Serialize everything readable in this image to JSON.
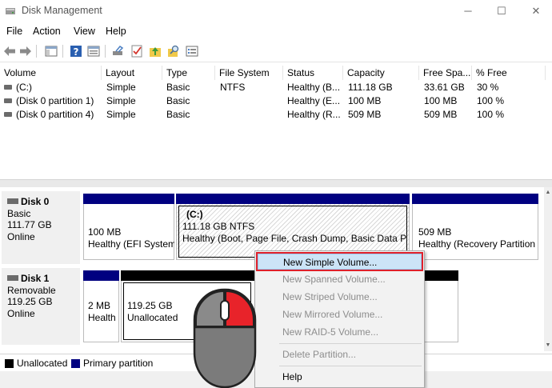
{
  "window": {
    "title": "Disk Management",
    "controls": {
      "minimize": "─",
      "maximize": "☐",
      "close": "✕"
    }
  },
  "menu": [
    "File",
    "Action",
    "View",
    "Help"
  ],
  "toolbar_icons": [
    "back-arrow-icon",
    "forward-arrow-icon",
    "console-tree-icon",
    "help-icon",
    "properties-icon",
    "connect-drive-icon",
    "check-icon",
    "up-folder-icon",
    "search-icon",
    "list-view-icon"
  ],
  "volumes": {
    "columns": [
      "Volume",
      "Layout",
      "Type",
      "File System",
      "Status",
      "Capacity",
      "Free Spa...",
      "% Free"
    ],
    "rows": [
      [
        "(C:)",
        "Simple",
        "Basic",
        "NTFS",
        "Healthy (B...",
        "111.18 GB",
        "33.61 GB",
        "30 %"
      ],
      [
        "(Disk 0 partition 1)",
        "Simple",
        "Basic",
        "",
        "Healthy (E...",
        "100 MB",
        "100 MB",
        "100 %"
      ],
      [
        "(Disk 0 partition 4)",
        "Simple",
        "Basic",
        "",
        "Healthy (R...",
        "509 MB",
        "509 MB",
        "100 %"
      ]
    ]
  },
  "disks": [
    {
      "name": "Disk 0",
      "type": "Basic",
      "size": "111.77 GB",
      "state": "Online",
      "partitions": [
        {
          "title": "",
          "line1": "100 MB",
          "line2": "Healthy (EFI System"
        },
        {
          "title": "(C:)",
          "line1": "111.18 GB NTFS",
          "line2": "Healthy (Boot, Page File, Crash Dump, Basic Data Parti"
        },
        {
          "title": "",
          "line1": "509 MB",
          "line2": "Healthy (Recovery Partition"
        }
      ]
    },
    {
      "name": "Disk 1",
      "type": "Removable",
      "size": "119.25 GB",
      "state": "Online",
      "partitions": [
        {
          "title": "",
          "line1": "2 MB",
          "line2": "Health"
        },
        {
          "title": "",
          "line1": "119.25 GB",
          "line2": "Unallocated"
        }
      ]
    }
  ],
  "legend": [
    {
      "label": "Unallocated",
      "color": "#000000"
    },
    {
      "label": "Primary partition",
      "color": "#000080"
    }
  ],
  "context_menu": {
    "items": [
      {
        "label": "New Simple Volume...",
        "enabled": true,
        "highlighted": true
      },
      {
        "label": "New Spanned Volume...",
        "enabled": false
      },
      {
        "label": "New Striped Volume...",
        "enabled": false
      },
      {
        "label": "New Mirrored Volume...",
        "enabled": false
      },
      {
        "label": "New RAID-5 Volume...",
        "enabled": false
      },
      {
        "label": "Delete Partition...",
        "enabled": false
      },
      {
        "label": "Help",
        "enabled": true
      }
    ]
  },
  "colors": {
    "primary_partition": "#000080",
    "unallocated": "#000000",
    "highlight_outline": "#e0202a",
    "mouse_button_highlight": "#e8232a"
  }
}
